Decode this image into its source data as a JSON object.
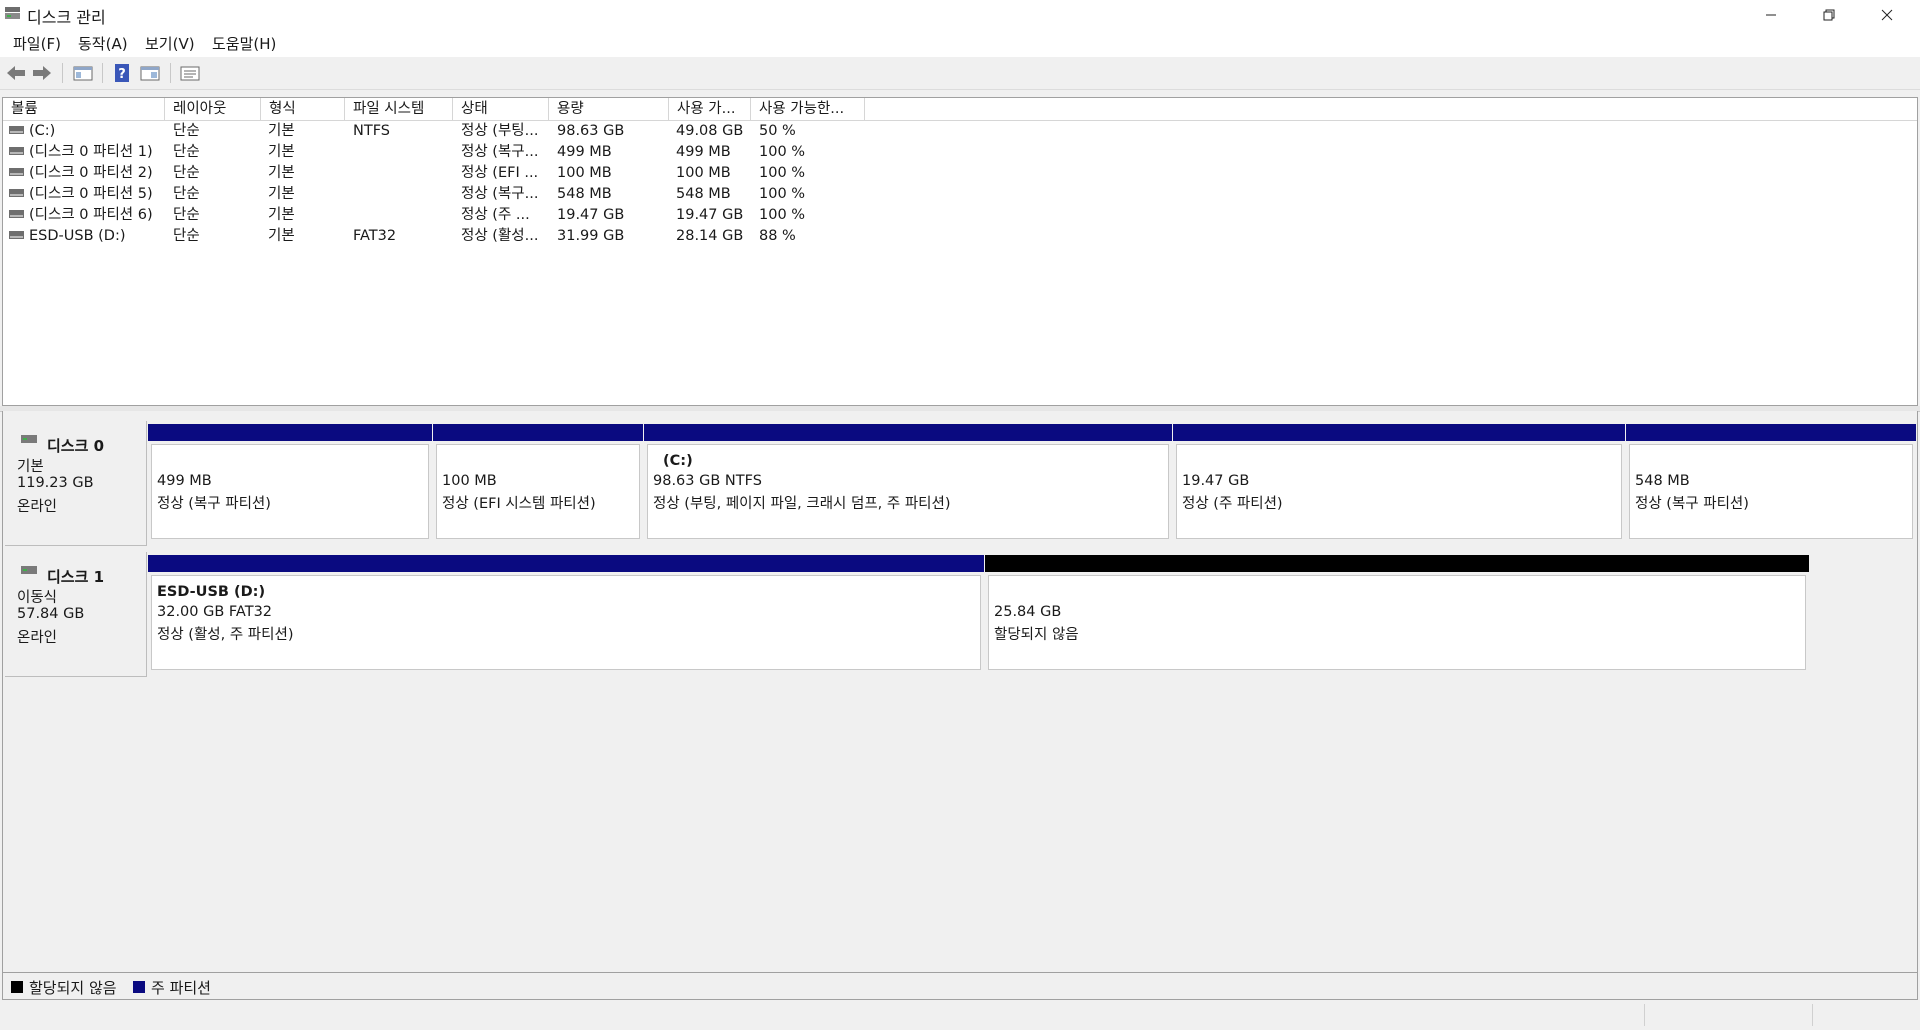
{
  "window": {
    "title": "디스크 관리",
    "icon": "disk-management-icon"
  },
  "menu": [
    {
      "label": "파일(F)"
    },
    {
      "label": "동작(A)"
    },
    {
      "label": "보기(V)"
    },
    {
      "label": "도움말(H)"
    }
  ],
  "toolbar": [
    "back-icon",
    "forward-icon",
    "show-hide-console-tree-icon",
    "help-icon",
    "properties-icon",
    "settings-icon"
  ],
  "volume_table": {
    "headers": [
      "볼륨",
      "레이아웃",
      "형식",
      "파일 시스템",
      "상태",
      "용량",
      "사용 가...",
      "사용 가능한..."
    ],
    "rows": [
      {
        "name": "(C:)",
        "layout": "단순",
        "type": "기본",
        "fs": "NTFS",
        "status": "정상 (부팅...",
        "capacity": "98.63 GB",
        "free": "49.08 GB",
        "pct": "50 %"
      },
      {
        "name": "(디스크 0 파티션 1)",
        "layout": "단순",
        "type": "기본",
        "fs": "",
        "status": "정상 (복구...",
        "capacity": "499 MB",
        "free": "499 MB",
        "pct": "100 %"
      },
      {
        "name": "(디스크 0 파티션 2)",
        "layout": "단순",
        "type": "기본",
        "fs": "",
        "status": "정상 (EFI ...",
        "capacity": "100 MB",
        "free": "100 MB",
        "pct": "100 %"
      },
      {
        "name": "(디스크 0 파티션 5)",
        "layout": "단순",
        "type": "기본",
        "fs": "",
        "status": "정상 (복구...",
        "capacity": "548 MB",
        "free": "548 MB",
        "pct": "100 %"
      },
      {
        "name": "(디스크 0 파티션 6)",
        "layout": "단순",
        "type": "기본",
        "fs": "",
        "status": "정상 (주 ...",
        "capacity": "19.47 GB",
        "free": "19.47 GB",
        "pct": "100 %"
      },
      {
        "name": "ESD-USB (D:)",
        "layout": "단순",
        "type": "기본",
        "fs": "FAT32",
        "status": "정상 (활성...",
        "capacity": "31.99 GB",
        "free": "28.14 GB",
        "pct": "88 %"
      }
    ]
  },
  "disks": [
    {
      "title": "디스크 0",
      "kind": "기본",
      "size": "119.23 GB",
      "state": "온라인",
      "partitions": [
        {
          "name": "",
          "size": "499 MB",
          "status": "정상 (복구 파티션)",
          "bar": "#0a0a80"
        },
        {
          "name": "",
          "size": "100 MB",
          "status": "정상 (EFI 시스템 파티션)",
          "bar": "#0a0a80"
        },
        {
          "name": "(C:)",
          "size": "98.63 GB NTFS",
          "status": "정상 (부팅, 페이지 파일, 크래시 덤프, 주 파티션)",
          "bar": "#0a0a80"
        },
        {
          "name": "",
          "size": "19.47 GB",
          "status": "정상 (주 파티션)",
          "bar": "#0a0a80"
        },
        {
          "name": "",
          "size": "548 MB",
          "status": "정상 (복구 파티션)",
          "bar": "#0a0a80"
        }
      ]
    },
    {
      "title": "디스크 1",
      "kind": "이동식",
      "size": "57.84 GB",
      "state": "온라인",
      "partitions": [
        {
          "name": "ESD-USB  (D:)",
          "size": "32.00 GB FAT32",
          "status": "정상 (활성, 주 파티션)",
          "bar": "#0a0a80"
        },
        {
          "name": "",
          "size": "25.84 GB",
          "status": "할당되지 않음",
          "bar": "#000000"
        }
      ]
    }
  ],
  "legend": [
    {
      "label": "할당되지 않음",
      "color": "#000000"
    },
    {
      "label": "주 파티션",
      "color": "#0a0a80"
    }
  ]
}
